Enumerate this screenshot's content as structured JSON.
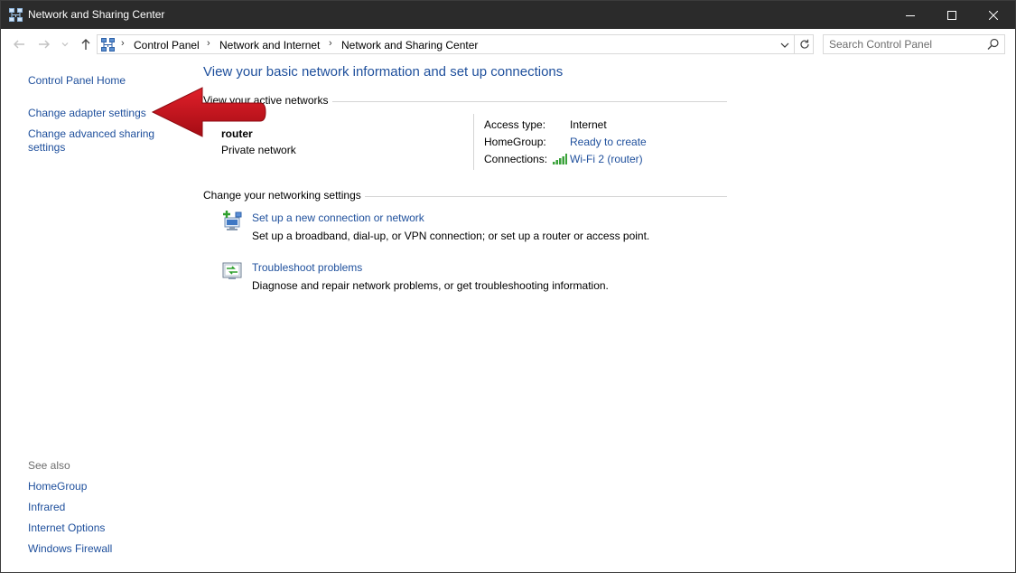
{
  "window": {
    "title": "Network and Sharing Center",
    "icon": "network-center-icon"
  },
  "address": {
    "crumbs": [
      "Control Panel",
      "Network and Internet",
      "Network and Sharing Center"
    ]
  },
  "search": {
    "placeholder": "Search Control Panel"
  },
  "sidebar": {
    "items": [
      {
        "label": "Control Panel Home"
      },
      {
        "label": "Change adapter settings"
      },
      {
        "label": "Change advanced sharing settings"
      }
    ],
    "see_also_label": "See also",
    "see_also": [
      {
        "label": "HomeGroup"
      },
      {
        "label": "Infrared"
      },
      {
        "label": "Internet Options"
      },
      {
        "label": "Windows Firewall"
      }
    ]
  },
  "main": {
    "title": "View your basic network information and set up connections",
    "active_networks_heading": "View your active networks",
    "network": {
      "name": "router",
      "type": "Private network",
      "access_type_label": "Access type:",
      "access_type_value": "Internet",
      "homegroup_label": "HomeGroup:",
      "homegroup_value": "Ready to create",
      "connections_label": "Connections:",
      "connections_value": "Wi-Fi 2 (router)"
    },
    "settings_heading": "Change your networking settings",
    "tasks": [
      {
        "icon": "new-connection-icon",
        "title": "Set up a new connection or network",
        "description": "Set up a broadband, dial-up, or VPN connection; or set up a router or access point."
      },
      {
        "icon": "troubleshoot-icon",
        "title": "Troubleshoot problems",
        "description": "Diagnose and repair network problems, or get troubleshooting information."
      }
    ]
  },
  "colors": {
    "link": "#1e4f9c",
    "titlebar": "#2b2b2b",
    "annotation_arrow": "#c8101a"
  }
}
